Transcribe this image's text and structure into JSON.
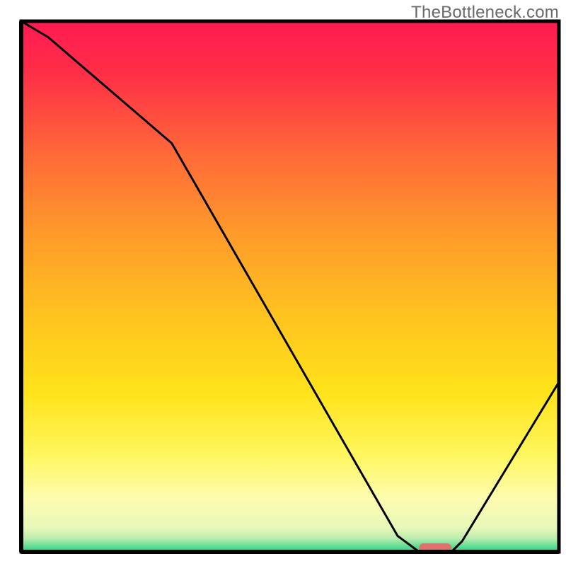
{
  "watermark": "TheBottleneck.com",
  "chart_data": {
    "type": "line",
    "title": "",
    "xlabel": "",
    "ylabel": "",
    "xlim": [
      0,
      100
    ],
    "ylim": [
      0,
      100
    ],
    "x": [
      0,
      5,
      28,
      70,
      74,
      80,
      82,
      100
    ],
    "y": [
      100,
      97,
      77,
      3,
      0,
      0,
      2,
      32
    ],
    "marker": {
      "x_start": 74,
      "x_end": 80,
      "y": 0,
      "color": "#e07070"
    },
    "gradient_stops": [
      {
        "offset": 0.0,
        "color": "#ff1a52"
      },
      {
        "offset": 0.1,
        "color": "#ff2f47"
      },
      {
        "offset": 0.25,
        "color": "#ff6938"
      },
      {
        "offset": 0.4,
        "color": "#ff9a2b"
      },
      {
        "offset": 0.55,
        "color": "#ffc21f"
      },
      {
        "offset": 0.7,
        "color": "#ffe31a"
      },
      {
        "offset": 0.82,
        "color": "#fff760"
      },
      {
        "offset": 0.9,
        "color": "#fdfcb0"
      },
      {
        "offset": 0.955,
        "color": "#e8f7b8"
      },
      {
        "offset": 0.975,
        "color": "#b9ecae"
      },
      {
        "offset": 0.995,
        "color": "#3fd98a"
      },
      {
        "offset": 1.0,
        "color": "#2bd183"
      }
    ],
    "axis_color": "#000000",
    "line_color": "#000000"
  }
}
